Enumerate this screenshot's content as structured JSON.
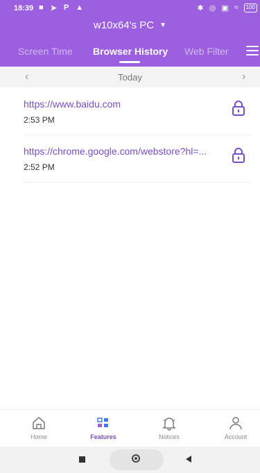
{
  "status_bar": {
    "time": "18:39",
    "left_icons": [
      "person-icon",
      "send-icon",
      "p-icon",
      "warning-icon"
    ],
    "right_icons": [
      "bluetooth-icon",
      "vibrate-off-icon",
      "sim-icon",
      "wifi-icon",
      "battery-icon"
    ],
    "battery_level": "100"
  },
  "header": {
    "device_name": "w10x64's PC",
    "tabs": [
      {
        "label": "Screen Time",
        "active": false
      },
      {
        "label": "Browser History",
        "active": true
      },
      {
        "label": "Web Filter",
        "active": false
      }
    ]
  },
  "date_nav": {
    "label": "Today",
    "prev_icon": "chevron-left-icon",
    "next_icon": "chevron-right-icon"
  },
  "history": [
    {
      "url": "https://www.baidu.com",
      "time": "2:53 PM",
      "icon": "lock-icon"
    },
    {
      "url": "https://chrome.google.com/webstore?hl=...",
      "time": "2:52 PM",
      "icon": "lock-icon"
    }
  ],
  "bottom_nav": [
    {
      "label": "Home",
      "icon": "home-icon",
      "active": false
    },
    {
      "label": "Features",
      "icon": "features-grid-icon",
      "active": true
    },
    {
      "label": "Notices",
      "icon": "bell-icon",
      "active": false
    },
    {
      "label": "Account",
      "icon": "account-icon",
      "active": false
    }
  ],
  "colors": {
    "primary": "#9b5fe0",
    "link": "#7a4dc1",
    "features_icon_blue": "#3d7be0",
    "features_icon_purple": "#9b5fe0"
  }
}
